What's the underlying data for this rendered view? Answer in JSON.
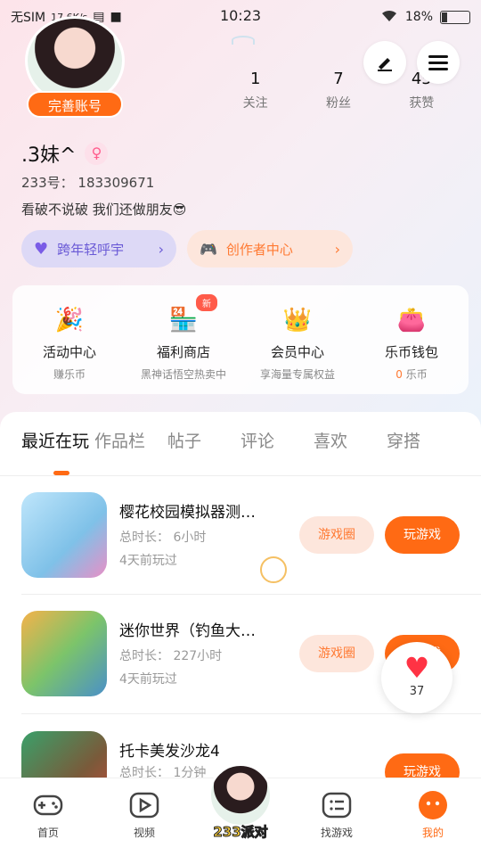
{
  "status_bar": {
    "carrier": "无SIM",
    "speed": "17.6K/s",
    "time": "10:23",
    "battery": "18%"
  },
  "profile": {
    "complete_button": "完善账号",
    "nickname": ".3妹^",
    "gender_symbol": "♀",
    "uid": "233号： 183309671",
    "signature": "看破不说破 我们还做朋友😎",
    "stats": [
      {
        "num": "1",
        "label": "关注"
      },
      {
        "num": "7",
        "label": "粉丝"
      },
      {
        "num": "45",
        "label": "获赞"
      }
    ]
  },
  "pills": {
    "left_label": "跨年轻呼宇",
    "right_label": "创作者中心"
  },
  "features": [
    {
      "title": "活动中心",
      "sub": "赚乐币",
      "icon": "party-popper-icon",
      "color": "#ff5b4a"
    },
    {
      "title": "福利商店",
      "sub": "黑神话悟空热卖中",
      "icon": "shop-icon",
      "color": "#ff8a2a",
      "badge": "新"
    },
    {
      "title": "会员中心",
      "sub": "享海量专属权益",
      "icon": "crown-icon",
      "color": "#ffc21a"
    },
    {
      "title": "乐币钱包",
      "sub_value": "0",
      "sub": "乐币",
      "icon": "wallet-icon",
      "color": "#ff7a33"
    }
  ],
  "tabs": [
    "最近在玩",
    "作品栏",
    "帖子",
    "评论",
    "喜欢",
    "穿搭"
  ],
  "games": [
    {
      "title": "樱花校园模拟器测…",
      "duration": "总时长： 6小时",
      "last": "4天前玩过",
      "circle_btn": "游戏圈",
      "play_btn": "玩游戏",
      "cover": "#9fd3f0"
    },
    {
      "title": "迷你世界（钓鱼大…",
      "duration": "总时长： 227小时",
      "last": "4天前玩过",
      "circle_btn": "游戏圈",
      "play_btn": "玩游戏",
      "cover": "#7cc46a"
    },
    {
      "title": "托卡美发沙龙4",
      "duration": "总时长： 1分钟",
      "last": "",
      "circle_btn": "",
      "play_btn": "玩游戏",
      "cover": "#3aa06a"
    }
  ],
  "like_float": {
    "count": "37"
  },
  "bottom_nav": [
    {
      "label": "首页",
      "icon": "gamepad-icon"
    },
    {
      "label": "视频",
      "icon": "play-icon"
    },
    {
      "label": "",
      "icon": "avatar"
    },
    {
      "label": "找游戏",
      "icon": "list-icon"
    },
    {
      "label": "我的",
      "icon": "me-icon"
    }
  ],
  "center_brand": "233派对",
  "accent": "#ff6a14"
}
